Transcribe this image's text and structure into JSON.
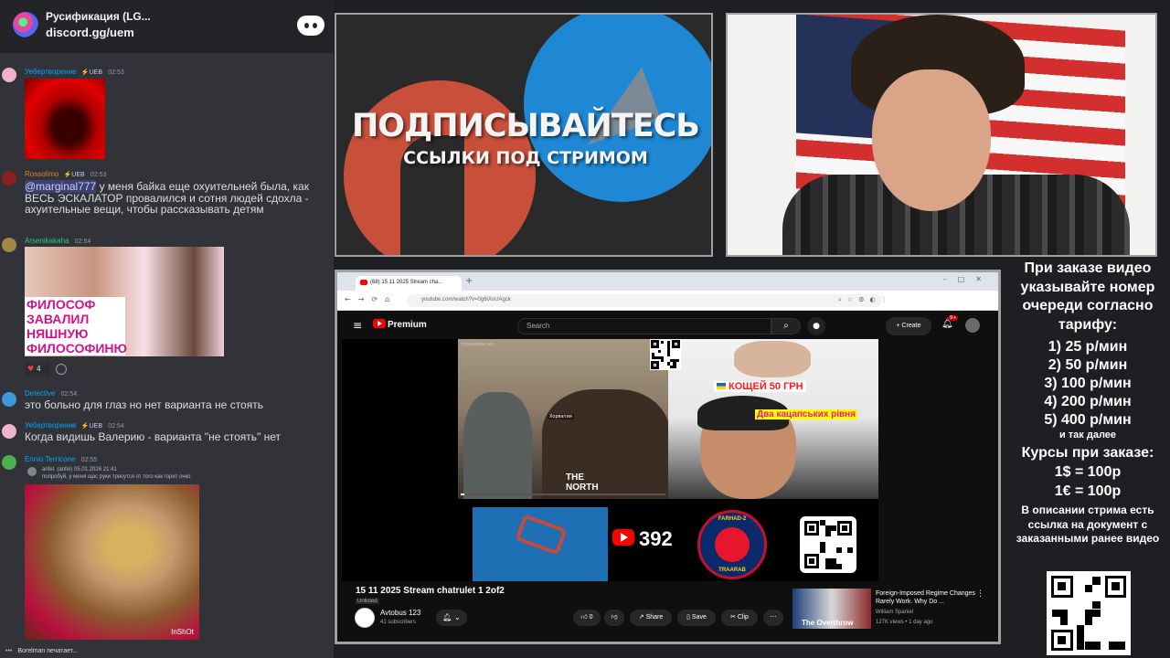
{
  "discord": {
    "server_name": "Русификация (LG...",
    "invite": "discord.gg/uem",
    "messages": [
      {
        "author": "Уебертворение",
        "badge": "⚡UEB",
        "time": "02:53",
        "text": ""
      },
      {
        "author": "Rossolimo",
        "badge": "⚡UEB",
        "time": "02:53",
        "mention": "@marginal777",
        "text": " у меня байка еще охуительней была, как ВЕСЬ ЭСКАЛАТОР провалился и сотня людей сдохла - ахуительные вещи, чтобы рассказывать детям"
      },
      {
        "author": "Arsenikakaha",
        "badge": "",
        "time": "02:54",
        "text": "",
        "image_caption": "ФИЛОСОФ\nЗАВАЛИЛ НЯШНУЮ\nФИЛОСОФИНЮ",
        "reaction_count": "4"
      },
      {
        "author": "Detective",
        "badge": "",
        "time": "02:54",
        "text": "это больно для глаз но нет варианта не стоять"
      },
      {
        "author": "Уебертворение",
        "badge": "⚡UEB",
        "time": "02:54",
        "text": "Когда видишь Валерию - варианта \"не стоять\" нет"
      },
      {
        "author": "Ennio Terricone",
        "badge": "",
        "time": "02:55",
        "reply_author": "anfel. (anfel) 05.01.2026 21:41",
        "reply_text": "попробуй, у меня щас руки трясутся от того как горит очко",
        "image_watermark": "InShOt"
      }
    ],
    "typing": "Borelman печатает..."
  },
  "banner": {
    "title": "ПОДПИСЫВАЙТЕСЬ",
    "subtitle": "ССЫЛКИ ПОД СТРИМОМ"
  },
  "browser": {
    "tab_title": "(68) 15 11 2025 Stream cha...",
    "url": "youtube.com/watch?v=0g6iXoUAgck",
    "youtube": {
      "logo": "Premium",
      "search_placeholder": "Search",
      "create_label": "Create",
      "notif_badge": "9+",
      "overlay_count": "392",
      "watermark_text": "Chatroulette.com",
      "shirt_text": "THE\nNORTH",
      "pane_label": "Хорватия",
      "tag_1": "КОЩЕЙ 50 ГРН",
      "tag_2": "Два кацапських рiвня",
      "badge_top": "FARHAD-2",
      "badge_bottom": "TRAARAB",
      "video_title": "15 11 2025 Stream chatrulet 1 2of2",
      "visibility": "Unlisted",
      "channel_name": "Avtobus 123",
      "channel_subs": "41 subscribers",
      "likes": "0",
      "share_label": "Share",
      "save_label": "Save",
      "clip_label": "Clip",
      "progress": 0.01,
      "recommendation": {
        "title": "Foreign-Imposed Regime Changes Rarely Work. Why Do ...",
        "channel": "William Spaniel",
        "meta": "127K views • 1 day ago",
        "thumb_text": "The Overthrow"
      }
    }
  },
  "info": {
    "order_note": "При заказе видео указывайте номер очереди согласно тарифу:",
    "tariffs": [
      "1) 25 р/мин",
      "2) 50 р/мин",
      "3) 100 р/мин",
      "4) 200 р/мин",
      "5) 400 р/мин"
    ],
    "etc": "и так далее",
    "rates_title": "Курсы при заказе:",
    "rates": [
      "1$ = 100р",
      "1€ = 100р"
    ],
    "description_note": "В описании стрима есть ссылка на документ с заказанными ранее видео"
  }
}
